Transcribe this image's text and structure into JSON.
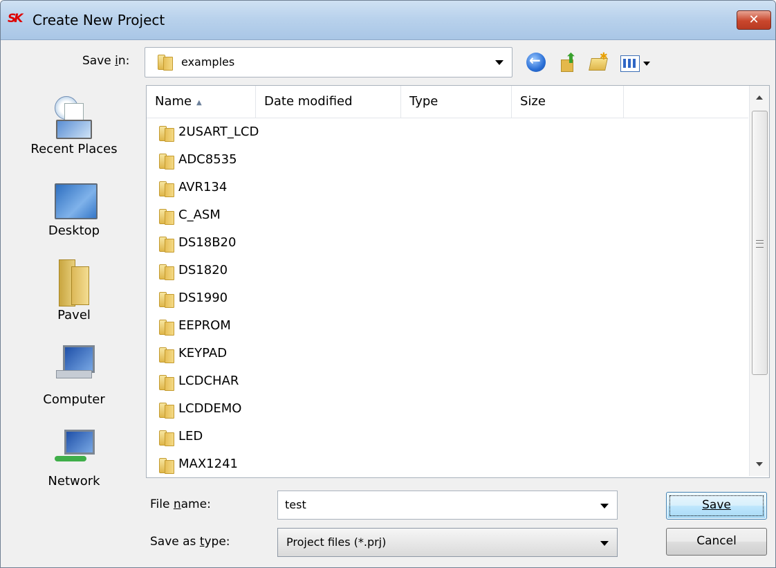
{
  "window": {
    "logo_text": "SK",
    "title": "Create New Project",
    "close_label": "✕"
  },
  "toolbar": {
    "save_in_label": "Save in:",
    "save_in_value": "examples",
    "icons": [
      "back-icon",
      "up-folder-icon",
      "new-folder-icon",
      "views-menu-icon"
    ]
  },
  "places": [
    {
      "label": "Recent Places",
      "icon": "recent-places-icon"
    },
    {
      "label": "Desktop",
      "icon": "desktop-icon"
    },
    {
      "label": "Pavel",
      "icon": "user-folder-icon"
    },
    {
      "label": "Computer",
      "icon": "computer-icon"
    },
    {
      "label": "Network",
      "icon": "network-icon"
    }
  ],
  "columns": [
    "Name",
    "Date modified",
    "Type",
    "Size"
  ],
  "files": [
    "2USART_LCD",
    "ADC8535",
    "AVR134",
    "C_ASM",
    "DS18B20",
    "DS1820",
    "DS1990",
    "EEPROM",
    "KEYPAD",
    "LCDCHAR",
    "LCDDEMO",
    "LED",
    "MAX1241"
  ],
  "form": {
    "file_name_label": "File name:",
    "file_name_value": "test",
    "save_type_label": "Save as type:",
    "save_type_value": "Project files (*.prj)"
  },
  "buttons": {
    "save": "Save",
    "cancel": "Cancel"
  },
  "colors": {
    "title_bar": "#b9d2ec",
    "close_button": "#c9462c",
    "default_button": "#bee6fd"
  }
}
